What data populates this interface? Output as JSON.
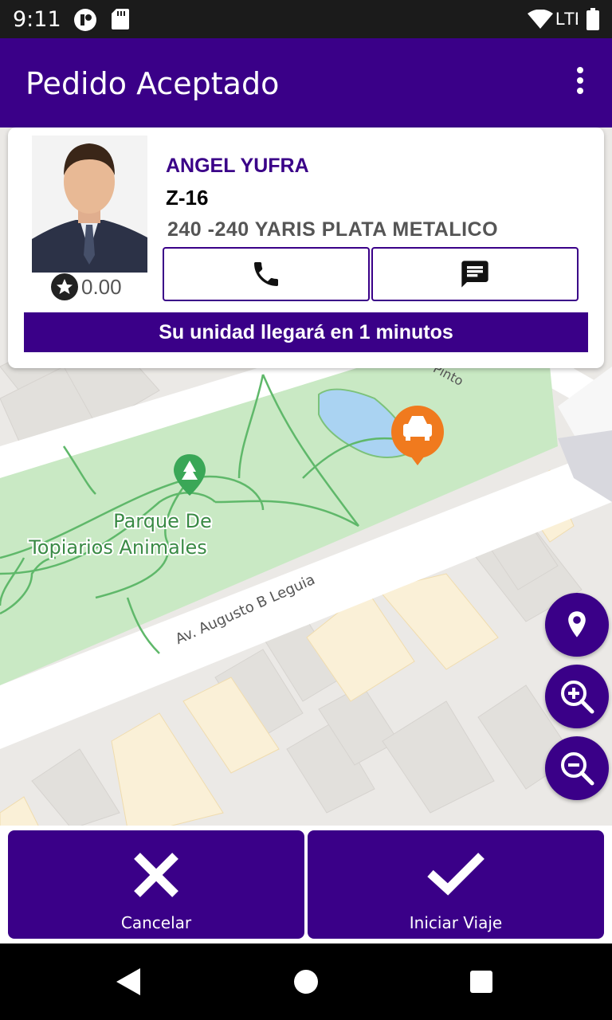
{
  "status_bar": {
    "time": "9:11",
    "network": "LTE"
  },
  "app_bar": {
    "title": "Pedido Aceptado"
  },
  "map": {
    "park_name_line1": "Parque De",
    "park_name_line2": "Topiarios Animales",
    "street_main": "Av. Augusto B Leguia",
    "street_partial": "Pinto"
  },
  "driver_card": {
    "name": "ANGEL YUFRA",
    "plate": "Z-16",
    "vehicle": "240 -240 YARIS PLATA METALICO",
    "rating": "0.00",
    "eta_message": "Su unidad llegará en 1 minutos"
  },
  "actions": {
    "cancel_label": "Cancelar",
    "start_label": "Iniciar Viaje"
  },
  "colors": {
    "primary": "#3a0088",
    "marker": "#f07a1e",
    "park": "#c9e9c4",
    "water": "#aad3f2"
  },
  "icons": [
    "phone-icon",
    "message-icon",
    "location-pin-icon",
    "zoom-in-icon",
    "zoom-out-icon",
    "close-icon",
    "check-icon"
  ]
}
